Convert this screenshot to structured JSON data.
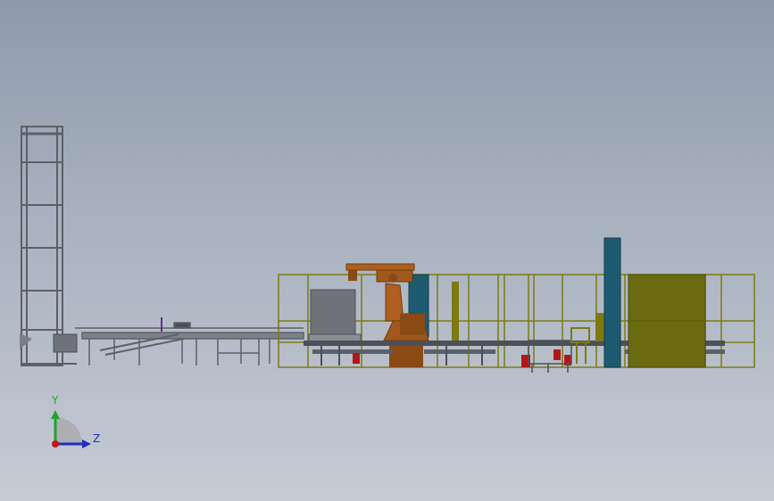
{
  "view": {
    "background_top": "#8e9aab",
    "background_bottom": "#c6cbd5"
  },
  "triad": {
    "y_label": "Y",
    "z_label": "Z",
    "y_color": "#1fa32b",
    "z_color": "#1f2fbf",
    "x_color": "#c21818"
  },
  "model_colors": {
    "frame_gray": "#5c6068",
    "cage_yellow": "#7d7a10",
    "robot_orange": "#a2581c",
    "column_teal": "#1f5b70",
    "panel_olive": "#6c6a10",
    "machine_gray": "#6f7278",
    "conveyor": "#4c5058",
    "accent_red": "#b01818",
    "accent_purple": "#6a2a8a"
  }
}
